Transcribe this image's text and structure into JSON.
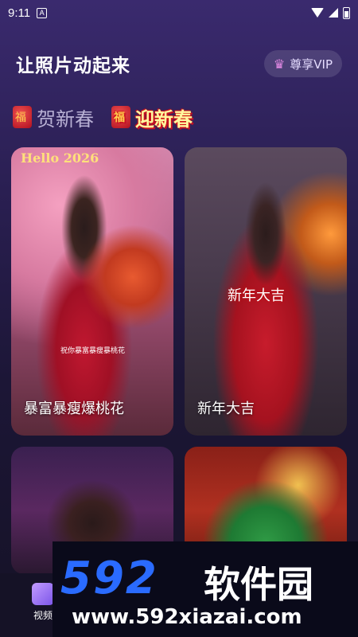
{
  "status_bar": {
    "time": "9:11",
    "notification_icon": "A"
  },
  "header": {
    "title": "让照片动起来",
    "vip_label": "尊享VIP"
  },
  "tabs": [
    {
      "label": "贺新春",
      "active": false
    },
    {
      "label": "迎新春",
      "active": true
    }
  ],
  "cards": [
    {
      "label": "暴富暴瘦爆桃花",
      "badge_text": "Hello 2026",
      "caption": "祝你暴富暴瘦暴桃花"
    },
    {
      "label": "新年大吉",
      "overlay_text": "新年大吉"
    },
    {
      "label": ""
    },
    {
      "label": ""
    }
  ],
  "bottom_nav": {
    "video_label": "视频"
  },
  "watermark": {
    "logo": "592",
    "name": "软件园",
    "url": "www.592xiazai.com"
  },
  "colors": {
    "accent": "#7a54e8",
    "tab_active": "#fff8a0",
    "watermark_blue": "#2a6bff"
  }
}
